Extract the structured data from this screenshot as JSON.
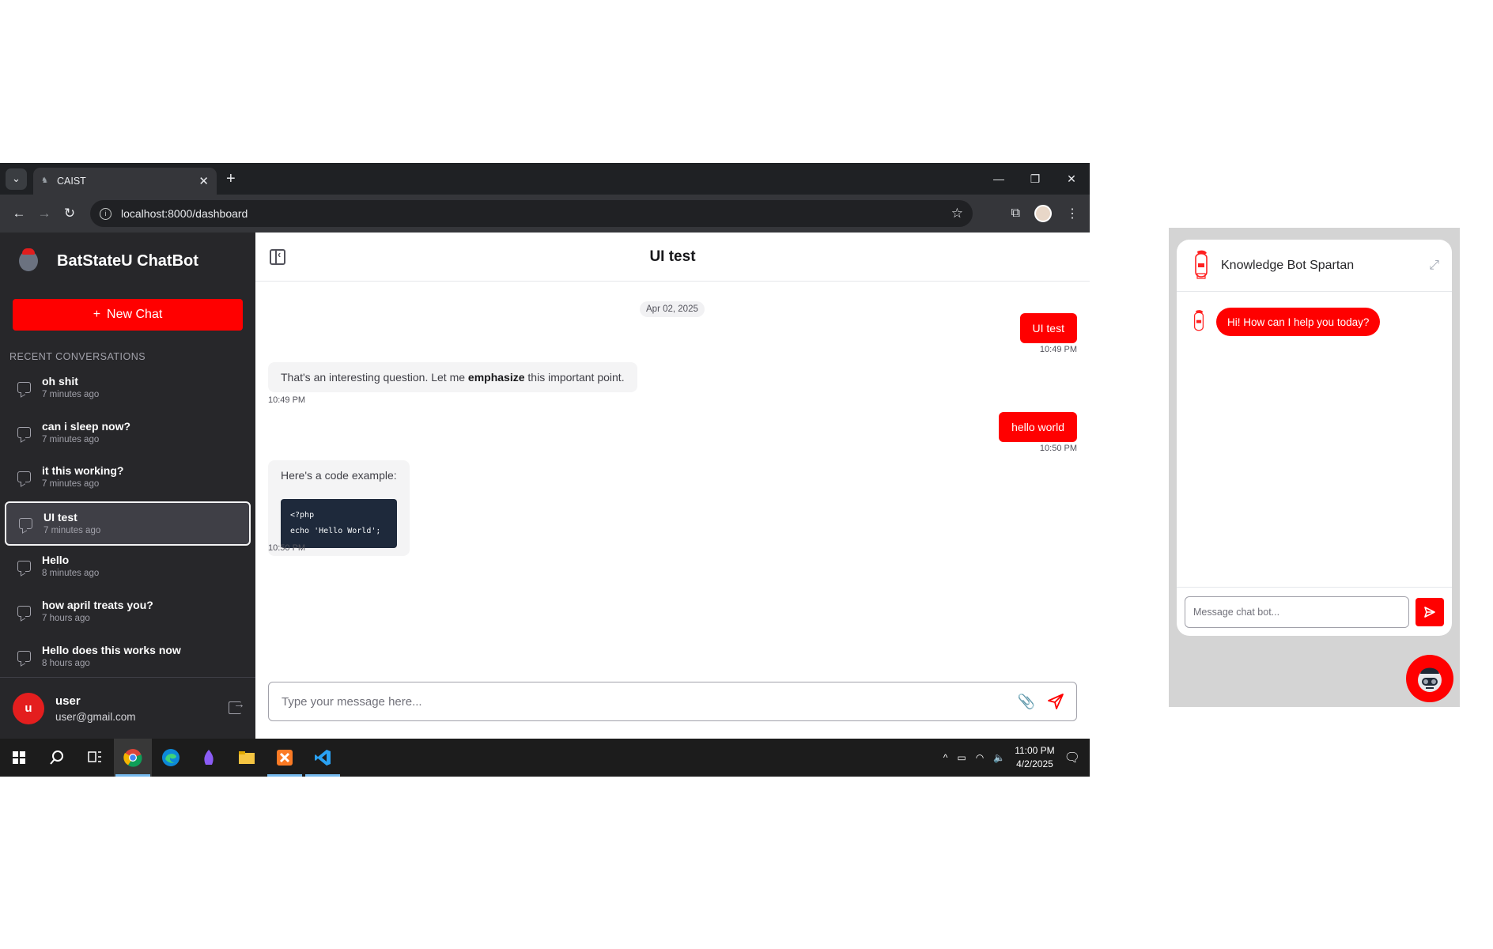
{
  "browser": {
    "tab_title": "CAIST",
    "url": "localhost:8000/dashboard"
  },
  "sidebar": {
    "brand": "BatStateU ChatBot",
    "new_chat": "New Chat",
    "recent_title": "RECENT CONVERSATIONS",
    "conversations": [
      {
        "title": "oh shit",
        "time": "7 minutes ago"
      },
      {
        "title": "can i sleep now?",
        "time": "7 minutes ago"
      },
      {
        "title": "it this working?",
        "time": "7 minutes ago"
      },
      {
        "title": "UI test",
        "time": "7 minutes ago"
      },
      {
        "title": "Hello",
        "time": "8 minutes ago"
      },
      {
        "title": "how april treats you?",
        "time": "7 hours ago"
      },
      {
        "title": "Hello does this works now",
        "time": "8 hours ago"
      }
    ],
    "active_index": 3,
    "user": {
      "initial": "u",
      "name": "user",
      "email": "user@gmail.com"
    }
  },
  "chat": {
    "title": "UI test",
    "date": "Apr 02, 2025",
    "messages": [
      {
        "role": "user",
        "text": "UI test",
        "time": "10:49 PM"
      },
      {
        "role": "bot",
        "text_before": "That's an interesting question. Let me ",
        "emphasis": "emphasize",
        "text_after": " this important point.",
        "time": "10:49 PM"
      },
      {
        "role": "user",
        "text": "hello world",
        "time": "10:50 PM"
      },
      {
        "role": "bot",
        "text": "Here's a code example:",
        "code": "<?php\necho 'Hello World';",
        "time": "10:50 PM"
      }
    ],
    "composer_placeholder": "Type your message here..."
  },
  "taskbar": {
    "time": "11:00 PM",
    "date": "4/2/2025"
  },
  "widget": {
    "title": "Knowledge Bot Spartan",
    "greeting": "Hi! How can I help you today?",
    "input_placeholder": "Message chat bot..."
  },
  "colors": {
    "accent": "#ff0000",
    "sidebar_bg": "#27272a",
    "browser_chrome": "#35363a"
  }
}
